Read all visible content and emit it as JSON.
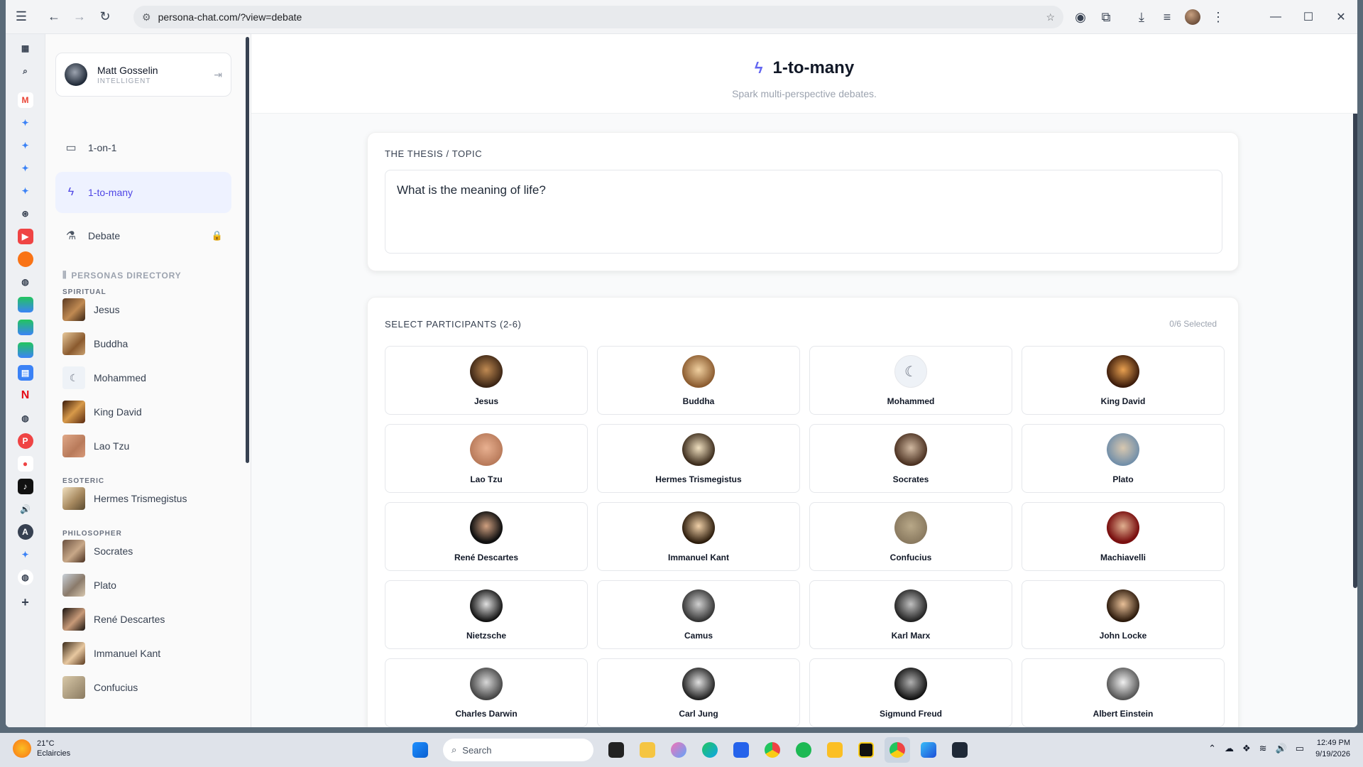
{
  "browser": {
    "url": "persona-chat.com/?view=debate"
  },
  "user": {
    "name": "Matt Gosselin",
    "role": "INTELLIGENT"
  },
  "nav": {
    "one_on_one": "1-on-1",
    "one_to_many": "1-to-many",
    "debate": "Debate"
  },
  "directory": {
    "title": "PERSONAS DIRECTORY",
    "categories": {
      "spiritual": "SPIRITUAL",
      "esoteric": "ESOTERIC",
      "philosopher": "PHILOSOPHER"
    },
    "spiritual": [
      "Jesus",
      "Buddha",
      "Mohammed",
      "King David",
      "Lao Tzu"
    ],
    "esoteric": [
      "Hermes Trismegistus"
    ],
    "philosopher": [
      "Socrates",
      "Plato",
      "René Descartes",
      "Immanuel Kant",
      "Confucius"
    ]
  },
  "header": {
    "title": "1-to-many",
    "subtitle": "Spark multi-perspective debates."
  },
  "thesis": {
    "label": "THE THESIS / TOPIC",
    "value": "What is the meaning of life?"
  },
  "participants": {
    "label": "SELECT PARTICIPANTS (2-6)",
    "selected": "0/6 Selected",
    "cards": [
      "Jesus",
      "Buddha",
      "Mohammed",
      "King David",
      "Lao Tzu",
      "Hermes Trismegistus",
      "Socrates",
      "Plato",
      "René Descartes",
      "Immanuel Kant",
      "Confucius",
      "Machiavelli",
      "Nietzsche",
      "Camus",
      "Karl Marx",
      "John Locke",
      "Charles Darwin",
      "Carl Jung",
      "Sigmund Freud",
      "Albert Einstein"
    ]
  },
  "taskbar": {
    "temp": "21°C",
    "weather": "Eclaircies",
    "search_placeholder": "Search",
    "time": "12:49 PM",
    "date": "9/19/2026"
  },
  "colors": {
    "accent": "#4f46e5",
    "accent_bg": "#eef2ff"
  }
}
